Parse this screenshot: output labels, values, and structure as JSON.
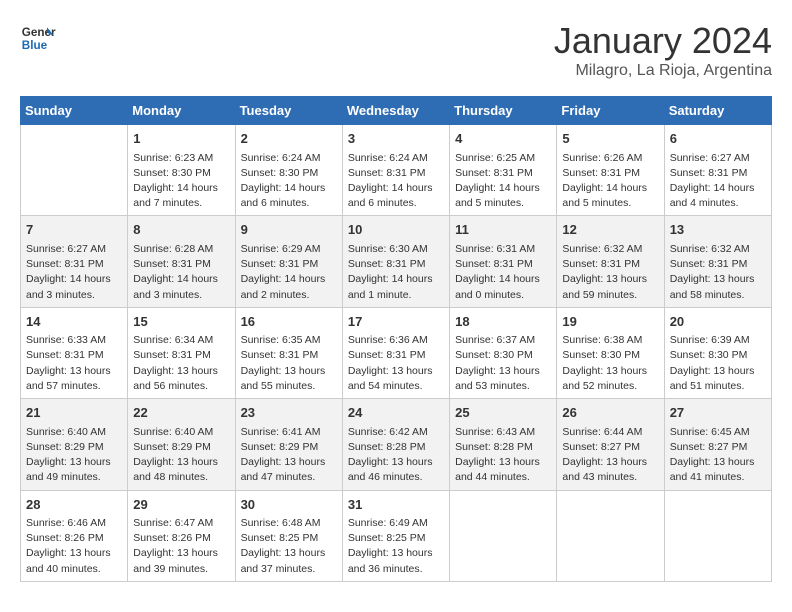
{
  "logo": {
    "line1": "General",
    "line2": "Blue"
  },
  "title": "January 2024",
  "location": "Milagro, La Rioja, Argentina",
  "days_header": [
    "Sunday",
    "Monday",
    "Tuesday",
    "Wednesday",
    "Thursday",
    "Friday",
    "Saturday"
  ],
  "weeks": [
    [
      {
        "day": "",
        "info": ""
      },
      {
        "day": "1",
        "info": "Sunrise: 6:23 AM\nSunset: 8:30 PM\nDaylight: 14 hours\nand 7 minutes."
      },
      {
        "day": "2",
        "info": "Sunrise: 6:24 AM\nSunset: 8:30 PM\nDaylight: 14 hours\nand 6 minutes."
      },
      {
        "day": "3",
        "info": "Sunrise: 6:24 AM\nSunset: 8:31 PM\nDaylight: 14 hours\nand 6 minutes."
      },
      {
        "day": "4",
        "info": "Sunrise: 6:25 AM\nSunset: 8:31 PM\nDaylight: 14 hours\nand 5 minutes."
      },
      {
        "day": "5",
        "info": "Sunrise: 6:26 AM\nSunset: 8:31 PM\nDaylight: 14 hours\nand 5 minutes."
      },
      {
        "day": "6",
        "info": "Sunrise: 6:27 AM\nSunset: 8:31 PM\nDaylight: 14 hours\nand 4 minutes."
      }
    ],
    [
      {
        "day": "7",
        "info": "Sunrise: 6:27 AM\nSunset: 8:31 PM\nDaylight: 14 hours\nand 3 minutes."
      },
      {
        "day": "8",
        "info": "Sunrise: 6:28 AM\nSunset: 8:31 PM\nDaylight: 14 hours\nand 3 minutes."
      },
      {
        "day": "9",
        "info": "Sunrise: 6:29 AM\nSunset: 8:31 PM\nDaylight: 14 hours\nand 2 minutes."
      },
      {
        "day": "10",
        "info": "Sunrise: 6:30 AM\nSunset: 8:31 PM\nDaylight: 14 hours\nand 1 minute."
      },
      {
        "day": "11",
        "info": "Sunrise: 6:31 AM\nSunset: 8:31 PM\nDaylight: 14 hours\nand 0 minutes."
      },
      {
        "day": "12",
        "info": "Sunrise: 6:32 AM\nSunset: 8:31 PM\nDaylight: 13 hours\nand 59 minutes."
      },
      {
        "day": "13",
        "info": "Sunrise: 6:32 AM\nSunset: 8:31 PM\nDaylight: 13 hours\nand 58 minutes."
      }
    ],
    [
      {
        "day": "14",
        "info": "Sunrise: 6:33 AM\nSunset: 8:31 PM\nDaylight: 13 hours\nand 57 minutes."
      },
      {
        "day": "15",
        "info": "Sunrise: 6:34 AM\nSunset: 8:31 PM\nDaylight: 13 hours\nand 56 minutes."
      },
      {
        "day": "16",
        "info": "Sunrise: 6:35 AM\nSunset: 8:31 PM\nDaylight: 13 hours\nand 55 minutes."
      },
      {
        "day": "17",
        "info": "Sunrise: 6:36 AM\nSunset: 8:31 PM\nDaylight: 13 hours\nand 54 minutes."
      },
      {
        "day": "18",
        "info": "Sunrise: 6:37 AM\nSunset: 8:30 PM\nDaylight: 13 hours\nand 53 minutes."
      },
      {
        "day": "19",
        "info": "Sunrise: 6:38 AM\nSunset: 8:30 PM\nDaylight: 13 hours\nand 52 minutes."
      },
      {
        "day": "20",
        "info": "Sunrise: 6:39 AM\nSunset: 8:30 PM\nDaylight: 13 hours\nand 51 minutes."
      }
    ],
    [
      {
        "day": "21",
        "info": "Sunrise: 6:40 AM\nSunset: 8:29 PM\nDaylight: 13 hours\nand 49 minutes."
      },
      {
        "day": "22",
        "info": "Sunrise: 6:40 AM\nSunset: 8:29 PM\nDaylight: 13 hours\nand 48 minutes."
      },
      {
        "day": "23",
        "info": "Sunrise: 6:41 AM\nSunset: 8:29 PM\nDaylight: 13 hours\nand 47 minutes."
      },
      {
        "day": "24",
        "info": "Sunrise: 6:42 AM\nSunset: 8:28 PM\nDaylight: 13 hours\nand 46 minutes."
      },
      {
        "day": "25",
        "info": "Sunrise: 6:43 AM\nSunset: 8:28 PM\nDaylight: 13 hours\nand 44 minutes."
      },
      {
        "day": "26",
        "info": "Sunrise: 6:44 AM\nSunset: 8:27 PM\nDaylight: 13 hours\nand 43 minutes."
      },
      {
        "day": "27",
        "info": "Sunrise: 6:45 AM\nSunset: 8:27 PM\nDaylight: 13 hours\nand 41 minutes."
      }
    ],
    [
      {
        "day": "28",
        "info": "Sunrise: 6:46 AM\nSunset: 8:26 PM\nDaylight: 13 hours\nand 40 minutes."
      },
      {
        "day": "29",
        "info": "Sunrise: 6:47 AM\nSunset: 8:26 PM\nDaylight: 13 hours\nand 39 minutes."
      },
      {
        "day": "30",
        "info": "Sunrise: 6:48 AM\nSunset: 8:25 PM\nDaylight: 13 hours\nand 37 minutes."
      },
      {
        "day": "31",
        "info": "Sunrise: 6:49 AM\nSunset: 8:25 PM\nDaylight: 13 hours\nand 36 minutes."
      },
      {
        "day": "",
        "info": ""
      },
      {
        "day": "",
        "info": ""
      },
      {
        "day": "",
        "info": ""
      }
    ]
  ]
}
